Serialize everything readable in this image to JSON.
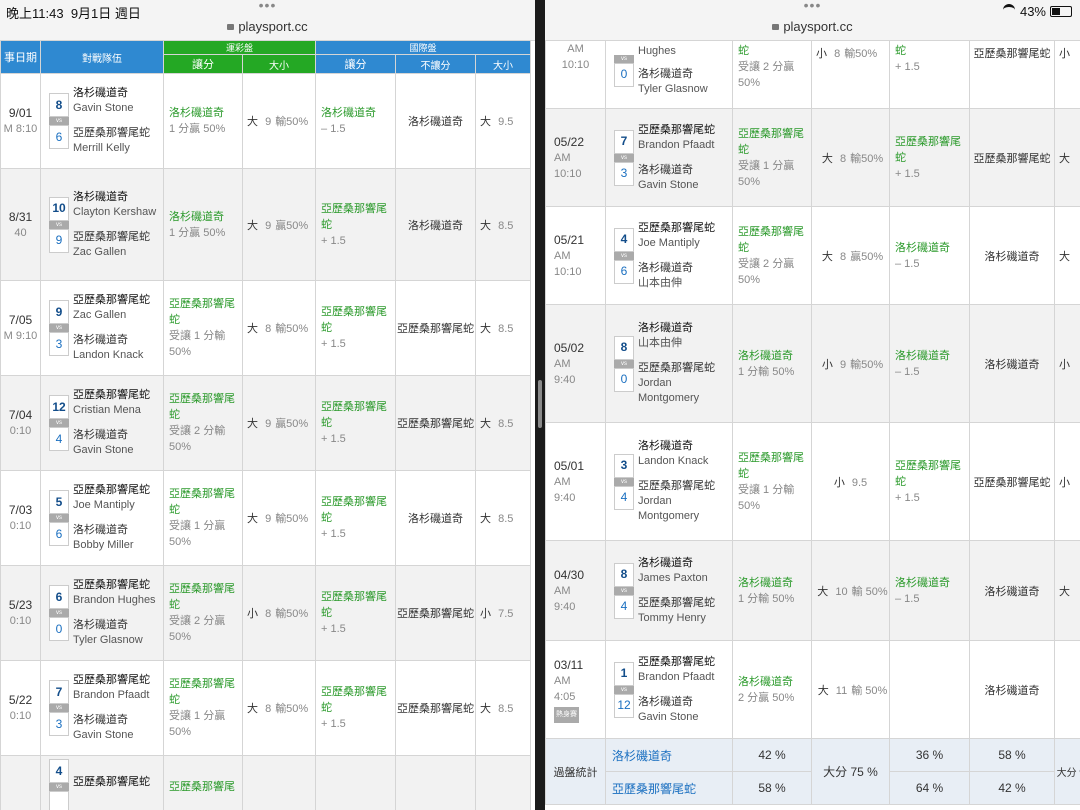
{
  "status": {
    "time": "晚上11:43",
    "date": "9月1日 週日",
    "wifi_battery": "43%"
  },
  "url": "playsport.cc",
  "left": {
    "headers": {
      "date": "事日期",
      "teams": "對戰隊伍",
      "top_green": "運彩盤",
      "top_blue": "國際盤",
      "spread": "讓分",
      "ou": "大小",
      "spread2": "讓分",
      "nospread": "不讓分",
      "ou2": "大小"
    },
    "rows": [
      {
        "date": "9/01",
        "time": "M 8:10",
        "s1": "8",
        "s2": "6",
        "t1": "洛杉磯道奇",
        "p1": "Gavin Stone",
        "t2": "亞歷桑那響尾蛇",
        "p2": "Merrill Kelly",
        "sp": "洛杉磯道奇",
        "spd": "1 分贏 50%",
        "ou": "大",
        "oun": "9",
        "ouw": "輸50%",
        "isp": "洛杉磯道奇",
        "ispd": "– 1.5",
        "ns": "洛杉磯道奇",
        "iou": "大",
        "ioun": "9.5"
      },
      {
        "date": "8/31",
        "time": "40",
        "s1": "10",
        "s2": "9",
        "t1": "洛杉磯道奇",
        "p1": "Clayton Kershaw",
        "t2": "亞歷桑那響尾蛇",
        "p2": "Zac Gallen",
        "sp": "洛杉磯道奇",
        "spd": "1 分贏 50%",
        "ou": "大",
        "oun": "9",
        "ouw": "贏50%",
        "isp": "亞歷桑那響尾蛇",
        "ispd": "+ 1.5",
        "ns": "洛杉磯道奇",
        "iou": "大",
        "ioun": "8.5"
      },
      {
        "date": "7/05",
        "time": "M 9:10",
        "s1": "9",
        "s2": "3",
        "t1": "亞歷桑那響尾蛇",
        "p1": "Zac Gallen",
        "t2": "洛杉磯道奇",
        "p2": "Landon Knack",
        "sp": "亞歷桑那響尾蛇",
        "spd": "受讓 1 分輸 50%",
        "ou": "大",
        "oun": "8",
        "ouw": "輸50%",
        "isp": "亞歷桑那響尾蛇",
        "ispd": "+ 1.5",
        "ns": "亞歷桑那響尾蛇",
        "iou": "大",
        "ioun": "8.5"
      },
      {
        "date": "7/04",
        "time": "0:10",
        "s1": "12",
        "s2": "4",
        "t1": "亞歷桑那響尾蛇",
        "p1": "Cristian Mena",
        "t2": "洛杉磯道奇",
        "p2": "Gavin Stone",
        "sp": "亞歷桑那響尾蛇",
        "spd": "受讓 2 分輸 50%",
        "ou": "大",
        "oun": "9",
        "ouw": "贏50%",
        "isp": "亞歷桑那響尾蛇",
        "ispd": "+ 1.5",
        "ns": "亞歷桑那響尾蛇",
        "iou": "大",
        "ioun": "8.5"
      },
      {
        "date": "7/03",
        "time": "0:10",
        "s1": "5",
        "s2": "6",
        "t1": "亞歷桑那響尾蛇",
        "p1": "Joe Mantiply",
        "t2": "洛杉磯道奇",
        "p2": "Bobby Miller",
        "sp": "亞歷桑那響尾蛇",
        "spd": "受讓 1 分贏 50%",
        "ou": "大",
        "oun": "9",
        "ouw": "輸50%",
        "isp": "亞歷桑那響尾蛇",
        "ispd": "+ 1.5",
        "ns": "洛杉磯道奇",
        "iou": "大",
        "ioun": "8.5"
      },
      {
        "date": "5/23",
        "time": "0:10",
        "s1": "6",
        "s2": "0",
        "t1": "亞歷桑那響尾蛇",
        "p1": "Brandon Hughes",
        "t2": "洛杉磯道奇",
        "p2": "Tyler Glasnow",
        "sp": "亞歷桑那響尾蛇",
        "spd": "受讓 2 分贏 50%",
        "ou": "小",
        "oun": "8",
        "ouw": "輸50%",
        "isp": "亞歷桑那響尾蛇",
        "ispd": "+ 1.5",
        "ns": "亞歷桑那響尾蛇",
        "iou": "小",
        "ioun": "7.5"
      },
      {
        "date": "5/22",
        "time": "0:10",
        "s1": "7",
        "s2": "3",
        "t1": "亞歷桑那響尾蛇",
        "p1": "Brandon Pfaadt",
        "t2": "洛杉磯道奇",
        "p2": "Gavin Stone",
        "sp": "亞歷桑那響尾蛇",
        "spd": "受讓 1 分贏 50%",
        "ou": "大",
        "oun": "8",
        "ouw": "輸50%",
        "isp": "亞歷桑那響尾蛇",
        "ispd": "+ 1.5",
        "ns": "亞歷桑那響尾蛇",
        "iou": "大",
        "ioun": "8.5"
      },
      {
        "date": "",
        "time": "",
        "s1": "4",
        "s2": "",
        "t1": "亞歷桑那響尾蛇",
        "p1": "",
        "t2": "",
        "p2": "",
        "sp": "亞歷桑那響尾",
        "spd": "",
        "ou": "",
        "oun": "",
        "ouw": "",
        "isp": "",
        "ispd": "",
        "ns": "",
        "iou": "",
        "ioun": ""
      }
    ]
  },
  "right": {
    "top_partial": {
      "time1": "AM",
      "time2": "10:10",
      "p1": "Hughes",
      "s2": "0",
      "t2": "洛杉磯道奇",
      "p2": "Tyler Glasnow",
      "spd_top": "蛇",
      "spd": "受讓 2 分贏 50%",
      "ou": "小",
      "oun": "8",
      "ouw": "輸50%",
      "isp_top": "蛇",
      "ispd": "+ 1.5",
      "ns": "亞歷桑那響尾蛇",
      "iou": "小"
    },
    "rows": [
      {
        "date": "05/22",
        "ampm": "AM",
        "time": "10:10",
        "s1": "7",
        "s2": "3",
        "t1": "亞歷桑那響尾蛇",
        "p1": "Brandon Pfaadt",
        "t2": "洛杉磯道奇",
        "p2": "Gavin Stone",
        "sp": "亞歷桑那響尾蛇",
        "spd": "受讓 1 分贏 50%",
        "ou": "大",
        "oun": "8",
        "ouw": "輸50%",
        "isp": "亞歷桑那響尾蛇",
        "ispd": "+ 1.5",
        "ns": "亞歷桑那響尾蛇",
        "iou": "大",
        "hot": ""
      },
      {
        "date": "05/21",
        "ampm": "AM",
        "time": "10:10",
        "s1": "4",
        "s2": "6",
        "t1": "亞歷桑那響尾蛇",
        "p1": "Joe Mantiply",
        "t2": "洛杉磯道奇",
        "p2": "山本由伸",
        "sp": "亞歷桑那響尾蛇",
        "spd": "受讓 2 分贏 50%",
        "ou": "大",
        "oun": "8",
        "ouw": "贏50%",
        "isp": "洛杉磯道奇",
        "ispd": "– 1.5",
        "ns": "洛杉磯道奇",
        "iou": "大",
        "hot": ""
      },
      {
        "date": "05/02",
        "ampm": "AM",
        "time": "9:40",
        "s1": "8",
        "s2": "0",
        "t1": "洛杉磯道奇",
        "p1": "山本由伸",
        "t2": "亞歷桑那響尾蛇",
        "p2": "Jordan Montgomery",
        "sp": "洛杉磯道奇",
        "spd": "1 分輸 50%",
        "ou": "小",
        "oun": "9",
        "ouw": "輸50%",
        "isp": "洛杉磯道奇",
        "ispd": "– 1.5",
        "ns": "洛杉磯道奇",
        "iou": "小",
        "hot": ""
      },
      {
        "date": "05/01",
        "ampm": "AM",
        "time": "9:40",
        "s1": "3",
        "s2": "4",
        "t1": "洛杉磯道奇",
        "p1": "Landon Knack",
        "t2": "亞歷桑那響尾蛇",
        "p2": "Jordan Montgomery",
        "sp": "亞歷桑那響尾蛇",
        "spd": "受讓 1 分輸 50%",
        "ou": "小",
        "oun": "9.5",
        "ouw": "",
        "isp": "亞歷桑那響尾蛇",
        "ispd": "+ 1.5",
        "ns": "亞歷桑那響尾蛇",
        "iou": "小",
        "hot": ""
      },
      {
        "date": "04/30",
        "ampm": "AM",
        "time": "9:40",
        "s1": "8",
        "s2": "4",
        "t1": "洛杉磯道奇",
        "p1": "James Paxton",
        "t2": "亞歷桑那響尾蛇",
        "p2": "Tommy Henry",
        "sp": "洛杉磯道奇",
        "spd": "1 分輸 50%",
        "ou": "大",
        "oun": "10",
        "ouw": "輸 50%",
        "isp": "洛杉磯道奇",
        "ispd": "– 1.5",
        "ns": "洛杉磯道奇",
        "iou": "大",
        "hot": ""
      },
      {
        "date": "03/11",
        "ampm": "AM",
        "time": "4:05",
        "s1": "1",
        "s2": "12",
        "t1": "亞歷桑那響尾蛇",
        "p1": "Brandon Pfaadt",
        "t2": "洛杉磯道奇",
        "p2": "Gavin Stone",
        "sp": "洛杉磯道奇",
        "spd": "2 分贏 50%",
        "ou": "大",
        "oun": "11",
        "ouw": "輸 50%",
        "isp": "",
        "ispd": "",
        "ns": "洛杉磯道奇",
        "iou": "",
        "hot": "熱身賽"
      }
    ],
    "stats": {
      "label": "過盤統計",
      "team1": "洛杉磯道奇",
      "team2": "亞歷桑那響尾蛇",
      "t1_sp": "42 %",
      "t2_sp": "58 %",
      "ou": "大分 75 %",
      "t1_isp": "36 %",
      "t2_isp": "64 %",
      "t1_ns": "58 %",
      "t2_ns": "42 %",
      "last": "大分 %"
    }
  }
}
